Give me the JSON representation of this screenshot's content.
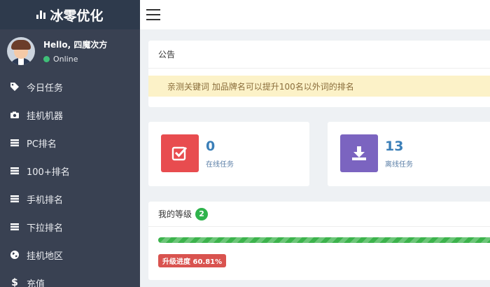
{
  "brand": {
    "title": "冰零优化"
  },
  "user": {
    "greeting": "Hello, 四魔次方",
    "status": "Online"
  },
  "menu": [
    {
      "label": "今日任务",
      "icon": "tag-icon"
    },
    {
      "label": "挂机机器",
      "icon": "camera-icon"
    },
    {
      "label": "PC排名",
      "icon": "server-icon"
    },
    {
      "label": "100+排名",
      "icon": "server-icon"
    },
    {
      "label": "手机排名",
      "icon": "server-icon"
    },
    {
      "label": "下拉排名",
      "icon": "server-icon"
    },
    {
      "label": "挂机地区",
      "icon": "globe-icon"
    },
    {
      "label": "充值",
      "icon": "dollar-icon"
    }
  ],
  "notice": {
    "title": "公告",
    "text": "亲测关键词 加品牌名可以提升100名以外词的排名"
  },
  "stats": [
    {
      "value": "0",
      "label": "在线任务",
      "color": "#e84c4f",
      "icon": "check-square-icon"
    },
    {
      "value": "13",
      "label": "离线任务",
      "color": "#7b64c0",
      "icon": "download-icon"
    }
  ],
  "level": {
    "title": "我的等级",
    "badge": "2",
    "progress_label": "升级进度 60.81%",
    "progress_percent": 60.81
  },
  "colors": {
    "sidebar": "#394152",
    "brand_bar": "#2e3a4c",
    "accent_green": "#3cb34c",
    "notice_bg": "#fcf2c8"
  }
}
